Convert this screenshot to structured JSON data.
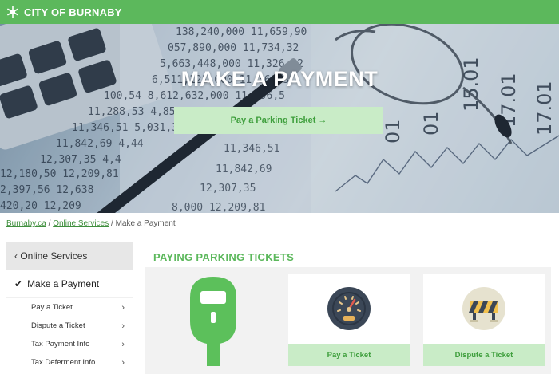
{
  "header": {
    "logo_text": "CITY OF BURNABY",
    "brand_color": "#5cb85c"
  },
  "hero": {
    "title": "MAKE A PAYMENT",
    "button_label": "Pay a Parking Ticket →"
  },
  "breadcrumb": {
    "home": "Burnaby.ca",
    "separator": "/",
    "online_services": "Online Services",
    "current": "Make a Payment"
  },
  "sidebar": {
    "back_label": "‹ Online Services",
    "active_label": "Make a Payment",
    "items": [
      {
        "label": "Pay a Ticket"
      },
      {
        "label": "Dispute a Ticket"
      },
      {
        "label": "Tax Payment Info"
      },
      {
        "label": "Tax Deferment Info"
      }
    ]
  },
  "main": {
    "section_title": "PAYING PARKING TICKETS",
    "cards": [
      {
        "label": "Pay a Ticket",
        "icon": "speedometer-icon"
      },
      {
        "label": "Dispute a Ticket",
        "icon": "barricade-icon"
      }
    ]
  }
}
